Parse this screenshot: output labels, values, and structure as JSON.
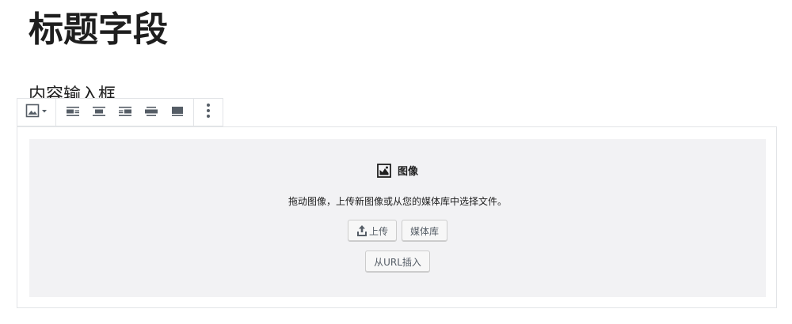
{
  "post": {
    "title": "标题字段",
    "paragraph": "内容输入框"
  },
  "toolbar": {
    "buttons": [
      {
        "name": "image-block-type-icon",
        "label": "image"
      },
      {
        "name": "align-left-icon",
        "label": "align-left"
      },
      {
        "name": "align-center-icon",
        "label": "align-center"
      },
      {
        "name": "align-right-icon",
        "label": "align-right"
      },
      {
        "name": "wide-width-icon",
        "label": "wide-width"
      },
      {
        "name": "full-width-icon",
        "label": "full-width"
      },
      {
        "name": "more-options-icon",
        "label": "more-vertical"
      }
    ]
  },
  "image_block": {
    "label": "图像",
    "instructions": "拖动图像，上传新图像或从您的媒体库中选择文件。",
    "upload_label": "上传",
    "media_library_label": "媒体库",
    "insert_url_label": "从URL插入"
  },
  "colors": {
    "placeholder_bg": "#f2f2f4",
    "border": "#e2e4e7",
    "text": "#1e1e1e",
    "button_text": "#555d66"
  }
}
